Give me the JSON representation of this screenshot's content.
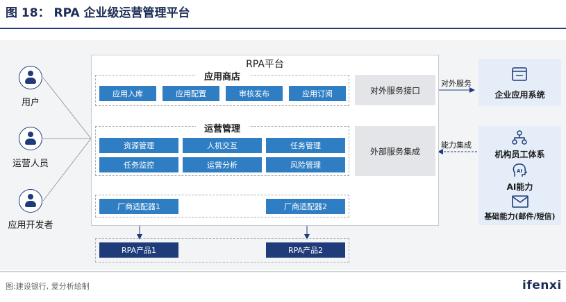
{
  "title": "图 18： RPA 企业级运营管理平台",
  "users": [
    "用户",
    "运营人员",
    "应用开发者"
  ],
  "platform": {
    "title": "RPA平台",
    "app_store": {
      "title": "应用商店",
      "modules": [
        "应用入库",
        "应用配置",
        "审核发布",
        "应用订阅"
      ]
    },
    "ops": {
      "title": "运营管理",
      "modules": [
        "资源管理",
        "人机交互",
        "任务管理",
        "任务监控",
        "运营分析",
        "风险管理"
      ]
    },
    "adapters": [
      "厂商适配器1",
      "厂商适配器2"
    ]
  },
  "products": [
    "RPA产品1",
    "RPA产品2"
  ],
  "interfaces": {
    "external": "对外服务接口",
    "internal": "外部服务集成"
  },
  "arrows": {
    "external": "对外服务",
    "internal": "能力集成"
  },
  "external_systems": {
    "enterprise": {
      "label": "企业应用系统",
      "icon": "window-icon"
    },
    "capabilities": [
      {
        "label": "机构员工体系",
        "icon": "org-chart-icon"
      },
      {
        "label": "AI能力",
        "icon": "ai-head-icon"
      },
      {
        "label": "基础能力(邮件/短信)",
        "icon": "envelope-icon"
      }
    ]
  },
  "source": "图:建设银行, 爱分析绘制",
  "logo": "ifenxi",
  "colors": {
    "module_blue": "#2f7ec4",
    "navy": "#1f3b79",
    "interface_gray": "#e4e5e8",
    "external_bg": "#e5eef8"
  }
}
